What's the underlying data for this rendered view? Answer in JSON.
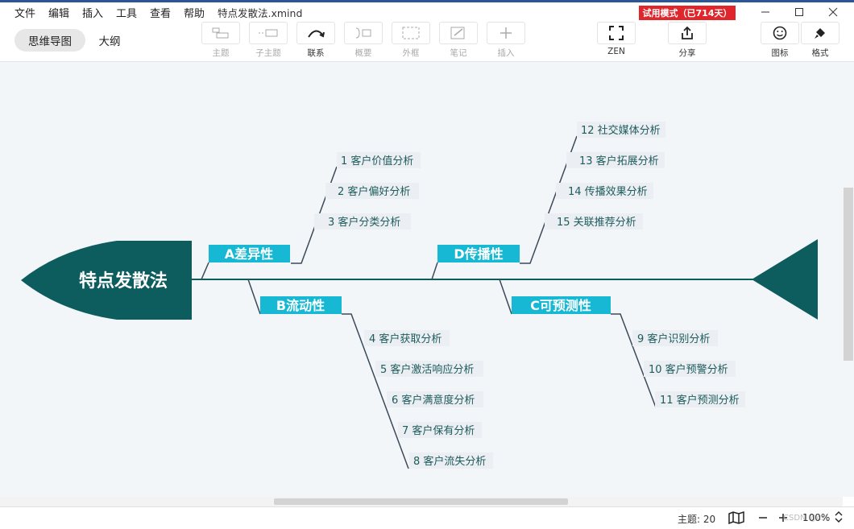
{
  "menu": [
    "文件",
    "编辑",
    "插入",
    "工具",
    "查看",
    "帮助"
  ],
  "file_name": "特点发散法.xmind",
  "trial_badge": "试用模式（已714天）",
  "window_controls": [
    "minimize-icon",
    "maximize-icon",
    "close-icon"
  ],
  "view_tabs": [
    "思维导图",
    "大纲"
  ],
  "toolbar": {
    "topic": "主题",
    "subtopic": "子主题",
    "relationship": "联系",
    "summary": "概要",
    "boundary": "外框",
    "note": "笔记",
    "insert": "插入",
    "zen": "ZEN",
    "share": "分享",
    "icon": "图标",
    "format": "格式"
  },
  "map": {
    "central": "特点发散法",
    "branches": [
      {
        "label": "A差异性",
        "items": [
          "1 客户价值分析",
          "2 客户偏好分析",
          "3 客户分类分析"
        ]
      },
      {
        "label": "B流动性",
        "items": [
          "4 客户获取分析",
          "5 客户激活响应分析",
          "6 客户满意度分析",
          "7 客户保有分析",
          "8 客户流失分析"
        ]
      },
      {
        "label": "D传播性",
        "items": [
          "12 社交媒体分析",
          "13 客户拓展分析",
          "14 传播效果分析",
          "15 关联推荐分析"
        ]
      },
      {
        "label": "C可预测性",
        "items": [
          "9 客户识别分析",
          "10 客户预警分析",
          "11 客户预测分析"
        ]
      }
    ],
    "colors": {
      "spine": "#0d5c5e",
      "branch_fill": "#16b8d4",
      "canvas": "#f3f6f9"
    }
  },
  "status": {
    "topic_count": "主题: 20",
    "zoom": "100%",
    "watermark": "CSDN @cst"
  }
}
